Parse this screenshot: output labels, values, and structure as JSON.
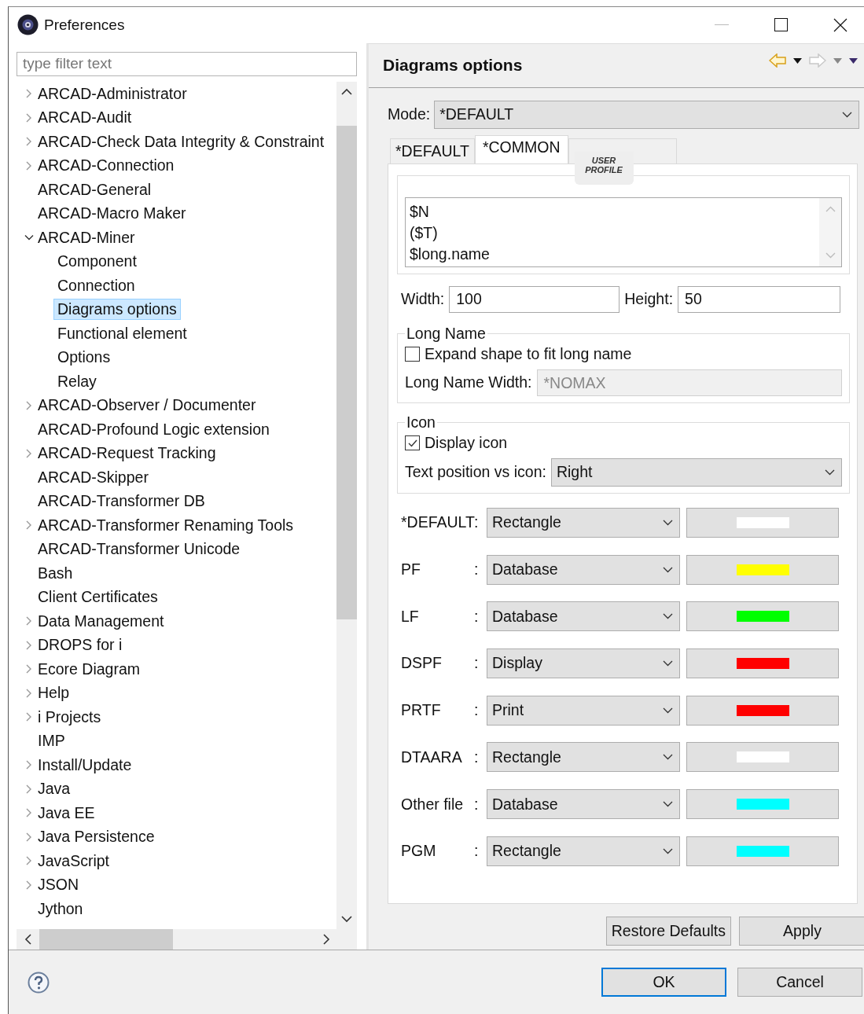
{
  "window": {
    "title": "Preferences"
  },
  "filter": {
    "placeholder": "type filter text"
  },
  "tree": [
    {
      "label": "ARCAD-Administrator",
      "kind": "branch",
      "expanded": false,
      "selected": false
    },
    {
      "label": "ARCAD-Audit",
      "kind": "branch",
      "expanded": false,
      "selected": false
    },
    {
      "label": "ARCAD-Check Data Integrity & Constraint",
      "kind": "branch",
      "expanded": false,
      "selected": false
    },
    {
      "label": "ARCAD-Connection",
      "kind": "branch",
      "expanded": false,
      "selected": false
    },
    {
      "label": "ARCAD-General",
      "kind": "leaf",
      "selected": false
    },
    {
      "label": "ARCAD-Macro Maker",
      "kind": "leaf",
      "selected": false
    },
    {
      "label": "ARCAD-Miner",
      "kind": "branch",
      "expanded": true,
      "selected": false,
      "children": [
        {
          "label": "Component",
          "selected": false
        },
        {
          "label": "Connection",
          "selected": false
        },
        {
          "label": "Diagrams options",
          "selected": true
        },
        {
          "label": "Functional element",
          "selected": false
        },
        {
          "label": "Options",
          "selected": false
        },
        {
          "label": "Relay",
          "selected": false
        }
      ]
    },
    {
      "label": "ARCAD-Observer / Documenter",
      "kind": "branch",
      "expanded": false,
      "selected": false
    },
    {
      "label": "ARCAD-Profound Logic extension",
      "kind": "leaf",
      "selected": false
    },
    {
      "label": "ARCAD-Request Tracking",
      "kind": "branch",
      "expanded": false,
      "selected": false
    },
    {
      "label": "ARCAD-Skipper",
      "kind": "leaf",
      "selected": false
    },
    {
      "label": "ARCAD-Transformer DB",
      "kind": "leaf",
      "selected": false
    },
    {
      "label": "ARCAD-Transformer Renaming Tools",
      "kind": "branch",
      "expanded": false,
      "selected": false
    },
    {
      "label": "ARCAD-Transformer Unicode",
      "kind": "leaf",
      "selected": false
    },
    {
      "label": "Bash",
      "kind": "leaf",
      "selected": false
    },
    {
      "label": "Client Certificates",
      "kind": "leaf",
      "selected": false
    },
    {
      "label": "Data Management",
      "kind": "branch",
      "expanded": false,
      "selected": false
    },
    {
      "label": "DROPS for i",
      "kind": "branch",
      "expanded": false,
      "selected": false
    },
    {
      "label": "Ecore Diagram",
      "kind": "branch",
      "expanded": false,
      "selected": false
    },
    {
      "label": "Help",
      "kind": "branch",
      "expanded": false,
      "selected": false
    },
    {
      "label": "i Projects",
      "kind": "branch",
      "expanded": false,
      "selected": false
    },
    {
      "label": "IMP",
      "kind": "leaf",
      "selected": false
    },
    {
      "label": "Install/Update",
      "kind": "branch",
      "expanded": false,
      "selected": false
    },
    {
      "label": "Java",
      "kind": "branch",
      "expanded": false,
      "selected": false
    },
    {
      "label": "Java EE",
      "kind": "branch",
      "expanded": false,
      "selected": false
    },
    {
      "label": "Java Persistence",
      "kind": "branch",
      "expanded": false,
      "selected": false
    },
    {
      "label": "JavaScript",
      "kind": "branch",
      "expanded": false,
      "selected": false
    },
    {
      "label": "JSON",
      "kind": "branch",
      "expanded": false,
      "selected": false
    },
    {
      "label": "Jython",
      "kind": "leaf",
      "selected": false
    }
  ],
  "page": {
    "title": "Diagrams options",
    "mode": {
      "label": "Mode:",
      "value": "*DEFAULT"
    },
    "tabs": [
      {
        "label": "*DEFAULT",
        "selected": false
      },
      {
        "label": "*COMMON",
        "selected": true
      },
      {
        "label": "USER PROFILE",
        "selected": false
      }
    ],
    "name_lines": [
      "$N",
      "($T)",
      "$long.name"
    ],
    "width": {
      "label": "Width:",
      "value": "100"
    },
    "height": {
      "label": "Height:",
      "value": "50"
    },
    "long_name": {
      "title": "Long Name",
      "expand": {
        "label": "Expand shape to fit long name",
        "checked": false
      },
      "width_label": "Long Name Width:",
      "width_value": "*NOMAX"
    },
    "icon": {
      "title": "Icon",
      "display": {
        "label": "Display icon",
        "checked": true
      },
      "position_label": "Text position vs icon:",
      "position_value": "Right"
    },
    "shapes": [
      {
        "label": "*DEFAULT",
        "separator": ":",
        "shape": "Rectangle",
        "color": "#ffffff"
      },
      {
        "label": "PF",
        "separator": ":",
        "shape": "Database",
        "color": "#ffff00"
      },
      {
        "label": "LF",
        "separator": ":",
        "shape": "Database",
        "color": "#00ff00"
      },
      {
        "label": "DSPF",
        "separator": ":",
        "shape": "Display",
        "color": "#ff0000"
      },
      {
        "label": "PRTF",
        "separator": ":",
        "shape": "Print",
        "color": "#ff0000"
      },
      {
        "label": "DTAARA",
        "separator": ":",
        "shape": "Rectangle",
        "color": "#ffffff"
      },
      {
        "label": "Other file",
        "separator": ":",
        "shape": "Database",
        "color": "#00ffff"
      },
      {
        "label": "PGM",
        "separator": ":",
        "shape": "Rectangle",
        "color": "#00ffff"
      }
    ],
    "buttons": [
      "Restore Defaults",
      "Apply"
    ]
  },
  "footer": {
    "buttons": [
      {
        "label": "OK",
        "selected": true
      },
      {
        "label": "Cancel",
        "selected": false
      }
    ]
  }
}
